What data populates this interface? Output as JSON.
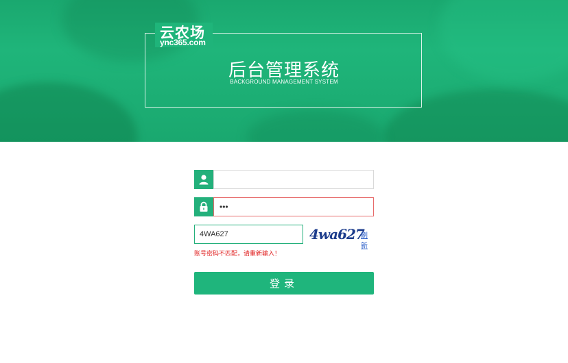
{
  "brand": {
    "logo_main": "云农场",
    "logo_sub": "ync365.com"
  },
  "hero": {
    "title": "后台管理系统",
    "subtitle": "BACKGROUND MANAGEMENT SYSTEM"
  },
  "form": {
    "username": {
      "value": "",
      "icon": "user-icon"
    },
    "password": {
      "value": "•••",
      "icon": "lock-icon"
    },
    "captcha": {
      "value": "4WA627",
      "image_text": "4wa627",
      "refresh_label": "刷新"
    },
    "error_message": "账号密码不匹配，请重新输入！",
    "submit_label": "登录"
  },
  "colors": {
    "accent": "#1fb57c",
    "error": "#e02020",
    "error_border": "#e76b6b",
    "link": "#2a5ec9"
  }
}
